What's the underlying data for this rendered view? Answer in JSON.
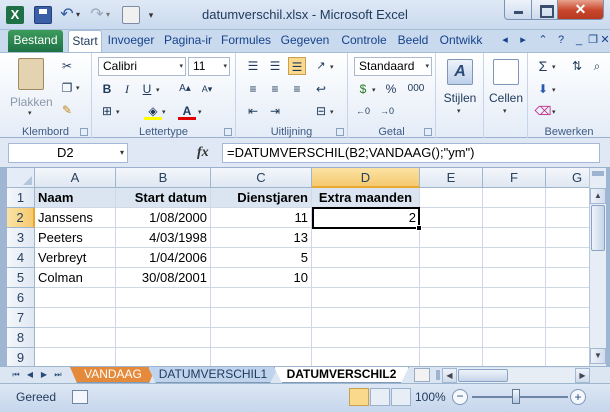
{
  "window": {
    "title": "datumverschil.xlsx - Microsoft Excel",
    "close_glyph": "✕"
  },
  "qat": {
    "app_glyph": "X",
    "undo_glyph": "↶",
    "redo_glyph": "↷",
    "dropdown_glyph": "▾"
  },
  "ribbon_tabs": [
    "Bestand",
    "Start",
    "Invoeger",
    "Pagina-ir",
    "Formules",
    "Gegeven",
    "Controle",
    "Beeld",
    "Ontwikk"
  ],
  "ribbon": {
    "clipboard": {
      "label": "Klembord",
      "paste": "Plakken"
    },
    "font": {
      "label": "Lettertype",
      "name": "Calibri",
      "size": "11",
      "bold": "B",
      "italic": "I",
      "underline": "U",
      "font_color_glyph": "A"
    },
    "alignment": {
      "label": "Uitlijning"
    },
    "number": {
      "label": "Getal",
      "format": "Standaard",
      "percent": "%",
      "thousands": "000"
    },
    "styles": {
      "label": "Stijlen"
    },
    "cells": {
      "label": "Cellen"
    },
    "editing": {
      "label": "Bewerken",
      "sum_glyph": "Σ"
    }
  },
  "formula_bar": {
    "name_box": "D2",
    "fx": "fx",
    "formula": "=DATUMVERSCHIL(B2;VANDAAG();\"ym\")"
  },
  "grid": {
    "columns": [
      "A",
      "B",
      "C",
      "D",
      "E",
      "F",
      "G"
    ],
    "rows": [
      "1",
      "2",
      "3",
      "4",
      "5",
      "6",
      "7",
      "8",
      "9"
    ],
    "headers": [
      "Naam",
      "Start datum",
      "Dienstjaren",
      "Extra maanden"
    ],
    "data": [
      [
        "Janssens",
        "1/08/2000",
        "11",
        "2"
      ],
      [
        "Peeters",
        "4/03/1998",
        "13",
        ""
      ],
      [
        "Verbreyt",
        "1/04/2006",
        "5",
        ""
      ],
      [
        "Colman",
        "30/08/2001",
        "10",
        ""
      ]
    ],
    "selected_cell": "D2"
  },
  "sheets": [
    "VANDAAG",
    "DATUMVERSCHIL1",
    "DATUMVERSCHIL2"
  ],
  "active_sheet": "DATUMVERSCHIL2",
  "sheet_tab_colors": {
    "VANDAAG": "#e58a3a"
  },
  "status": {
    "text": "Gereed",
    "zoom": "100%",
    "zoom_out": "−",
    "zoom_in": "+"
  }
}
